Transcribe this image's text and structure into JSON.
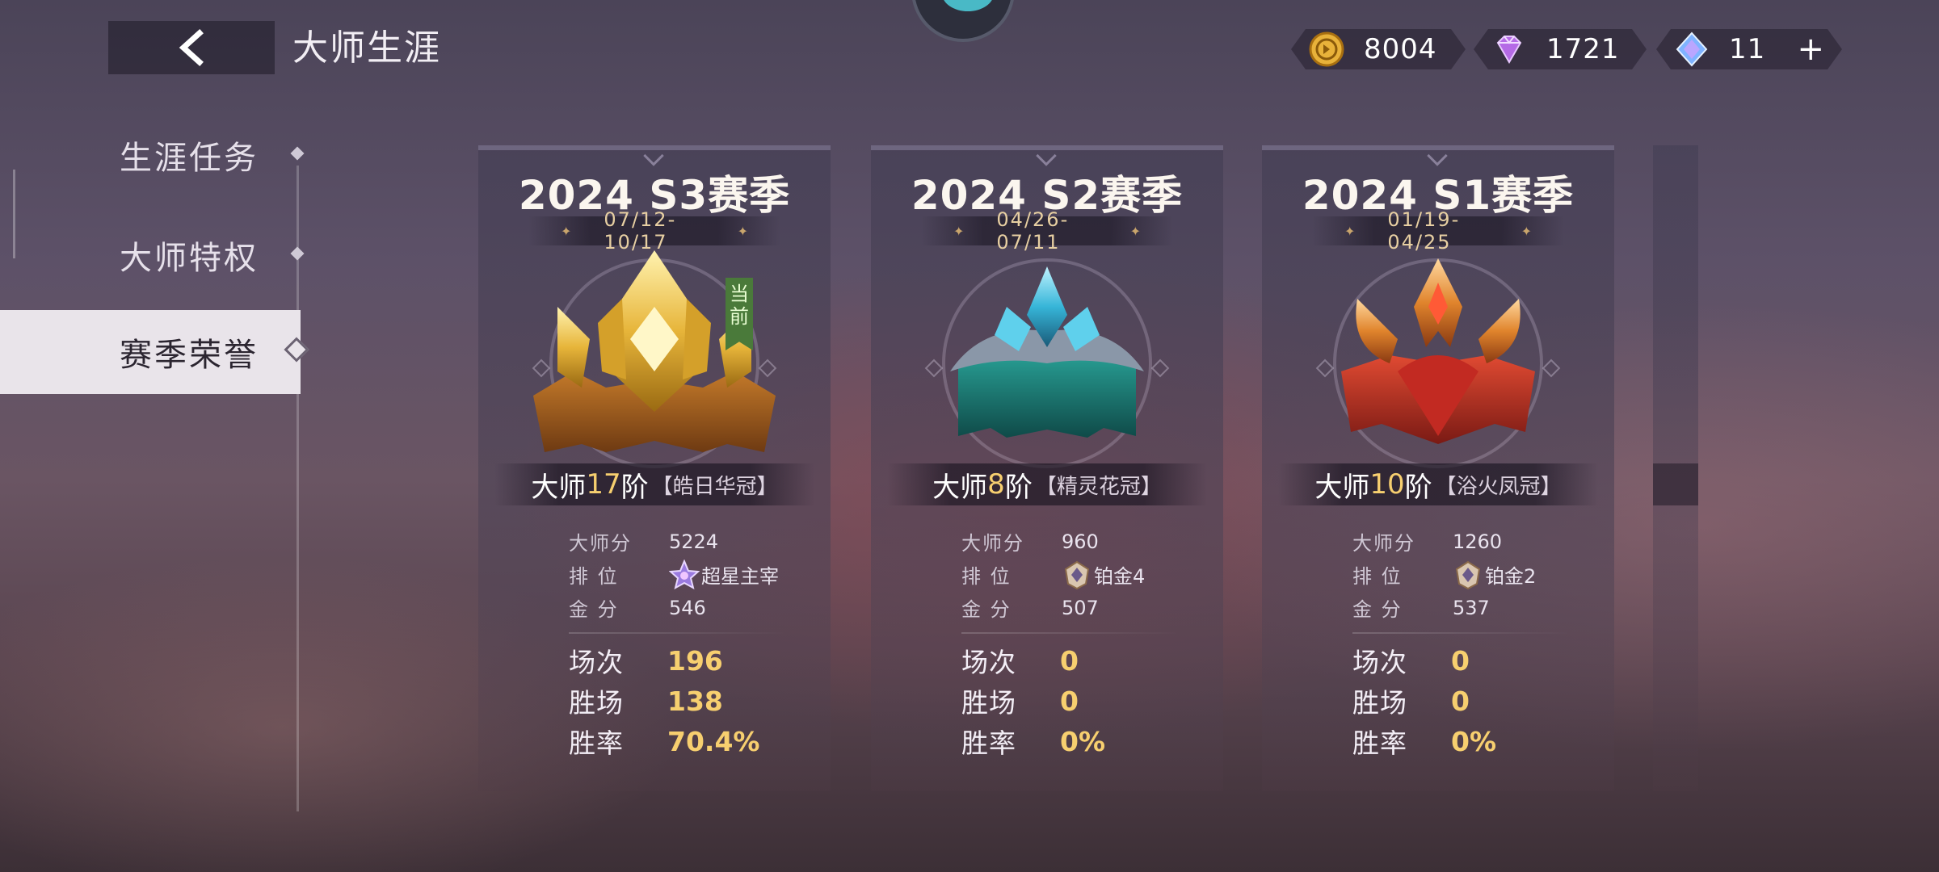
{
  "header": {
    "title": "大师生涯"
  },
  "currencies": [
    {
      "name": "coin",
      "value": "8004",
      "color": "#e8b23a"
    },
    {
      "name": "gem",
      "value": "1721",
      "color": "#b56ae6"
    },
    {
      "name": "crystal",
      "value": "11",
      "color": "#7fb3ff",
      "plus": "+"
    }
  ],
  "sidebar": {
    "items": [
      {
        "label": "生涯任务",
        "active": false
      },
      {
        "label": "大师特权",
        "active": false
      },
      {
        "label": "赛季荣誉",
        "active": true
      }
    ]
  },
  "seasons": [
    {
      "title": "2024 S3赛季",
      "dates": "07/12-10/17",
      "current_tag": "当前",
      "tier_prefix": "大师",
      "tier_num": "17",
      "tier_suffix": "阶",
      "crown_name": "【皓日华冠】",
      "crown_color": "#e7b53a",
      "master_score_label": "大师分",
      "master_score": "5224",
      "rank_label": "排 位",
      "rank": "超星主宰",
      "gold_label": "金 分",
      "gold": "546",
      "games_label": "场次",
      "games": "196",
      "wins_label": "胜场",
      "wins": "138",
      "winrate_label": "胜率",
      "winrate": "70.4%"
    },
    {
      "title": "2024 S2赛季",
      "dates": "04/26-07/11",
      "tier_prefix": "大师",
      "tier_num": "8",
      "tier_suffix": "阶",
      "crown_name": "【精灵花冠】",
      "crown_color": "#36b5d8",
      "master_score_label": "大师分",
      "master_score": "960",
      "rank_label": "排 位",
      "rank": "铂金4",
      "gold_label": "金 分",
      "gold": "507",
      "games_label": "场次",
      "games": "0",
      "wins_label": "胜场",
      "wins": "0",
      "winrate_label": "胜率",
      "winrate": "0%"
    },
    {
      "title": "2024 S1赛季",
      "dates": "01/19-04/25",
      "tier_prefix": "大师",
      "tier_num": "10",
      "tier_suffix": "阶",
      "crown_name": "【浴火凤冠】",
      "crown_color": "#d8442e",
      "master_score_label": "大师分",
      "master_score": "1260",
      "rank_label": "排 位",
      "rank": "铂金2",
      "gold_label": "金 分",
      "gold": "537",
      "games_label": "场次",
      "games": "0",
      "wins_label": "胜场",
      "wins": "0",
      "winrate_label": "胜率",
      "winrate": "0%"
    }
  ]
}
